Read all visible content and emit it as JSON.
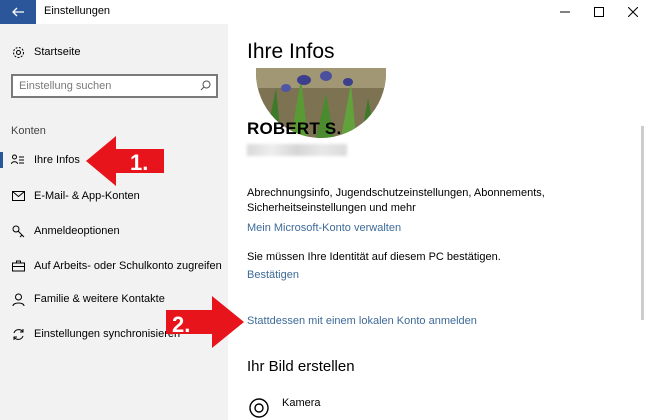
{
  "window": {
    "title": "Einstellungen"
  },
  "sidebar": {
    "home": "Startseite",
    "search_placeholder": "Einstellung suchen",
    "section": "Konten",
    "items": [
      {
        "label": "Ihre Infos",
        "icon": "person-list-icon"
      },
      {
        "label": "E-Mail- & App-Konten",
        "icon": "mail-icon"
      },
      {
        "label": "Anmeldeoptionen",
        "icon": "key-icon"
      },
      {
        "label": "Auf Arbeits- oder Schulkonto zugreifen",
        "icon": "briefcase-icon"
      },
      {
        "label": "Familie & weitere Kontakte",
        "icon": "people-icon"
      },
      {
        "label": "Einstellungen synchronisieren",
        "icon": "sync-icon"
      }
    ]
  },
  "main": {
    "title": "Ihre Infos",
    "user_name": "ROBERT S.",
    "billing_text": "Abrechnungsinfo, Jugendschutzeinstellungen, Abonnements, Sicherheitseinstellungen und mehr",
    "manage_link": "Mein Microsoft-Konto verwalten",
    "verify_text": "Sie müssen Ihre Identität auf diesem PC bestätigen.",
    "verify_link": "Bestätigen",
    "local_account_link": "Stattdessen mit einem lokalen Konto anmelden",
    "create_picture_heading": "Ihr Bild erstellen",
    "camera_label": "Kamera"
  },
  "annotations": {
    "step1": "1.",
    "step2": "2.",
    "color": "#e8141b"
  }
}
